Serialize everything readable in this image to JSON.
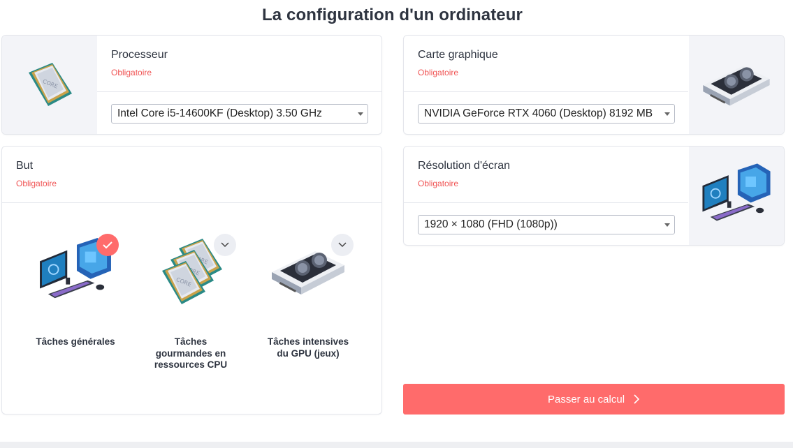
{
  "title": "La configuration d'un ordinateur",
  "processor": {
    "label": "Processeur",
    "required": "Obligatoire",
    "value": "Intel Core i5-14600KF (Desktop) 3.50 GHz",
    "image": "cpu-chip-icon"
  },
  "gpu": {
    "label": "Carte graphique",
    "required": "Obligatoire",
    "value": "NVIDIA GeForce RTX 4060 (Desktop) 8192 MB",
    "image": "graphics-card-icon"
  },
  "purpose": {
    "label": "But",
    "required": "Obligatoire",
    "options": [
      {
        "label": "Tâches générales",
        "icon": "desktop-setup-icon",
        "selected": true
      },
      {
        "label": "Tâches gourmandes en ressources CPU",
        "icon": "cpu-stack-icon",
        "selected": false
      },
      {
        "label": "Tâches intensives du GPU (jeux)",
        "icon": "graphics-card-icon",
        "selected": false
      }
    ]
  },
  "resolution": {
    "label": "Résolution d'écran",
    "required": "Obligatoire",
    "value": "1920 × 1080 (FHD (1080p))",
    "image": "desktop-setup-icon"
  },
  "submit": {
    "label": "Passer au calcul"
  },
  "colors": {
    "accent": "#ff6b6b",
    "required": "#f05454",
    "border": "#e4e6ec",
    "pane": "#f3f4f8"
  }
}
